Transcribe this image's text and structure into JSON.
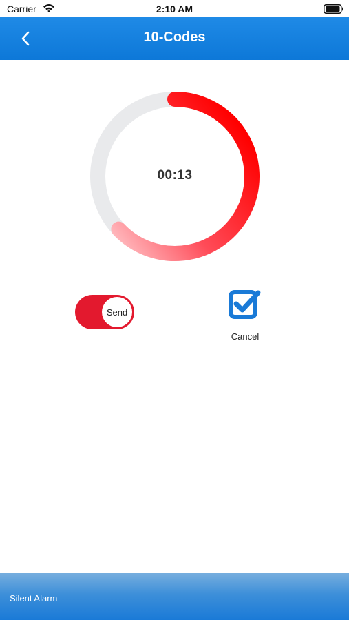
{
  "status_bar": {
    "carrier": "Carrier",
    "time": "2:10 AM",
    "icons": [
      "wifi-icon",
      "battery-icon"
    ]
  },
  "nav": {
    "title": "10-Codes",
    "back_icon": "chevron-left-icon"
  },
  "timer": {
    "value": "00:13",
    "progress": 0.63,
    "track_color": "#e9eaec",
    "progress_color": "#ff0000"
  },
  "toggle": {
    "label": "Send",
    "state": "on",
    "color": "#e3192e"
  },
  "cancel": {
    "label": "Cancel",
    "icon": "checkbox-checked-icon",
    "checked": true,
    "color": "#1a7ad7"
  },
  "bottom_bar": {
    "label": "Silent Alarm"
  },
  "colors": {
    "nav_blue": "#1f8ae6",
    "accent_red": "#ff0000"
  }
}
